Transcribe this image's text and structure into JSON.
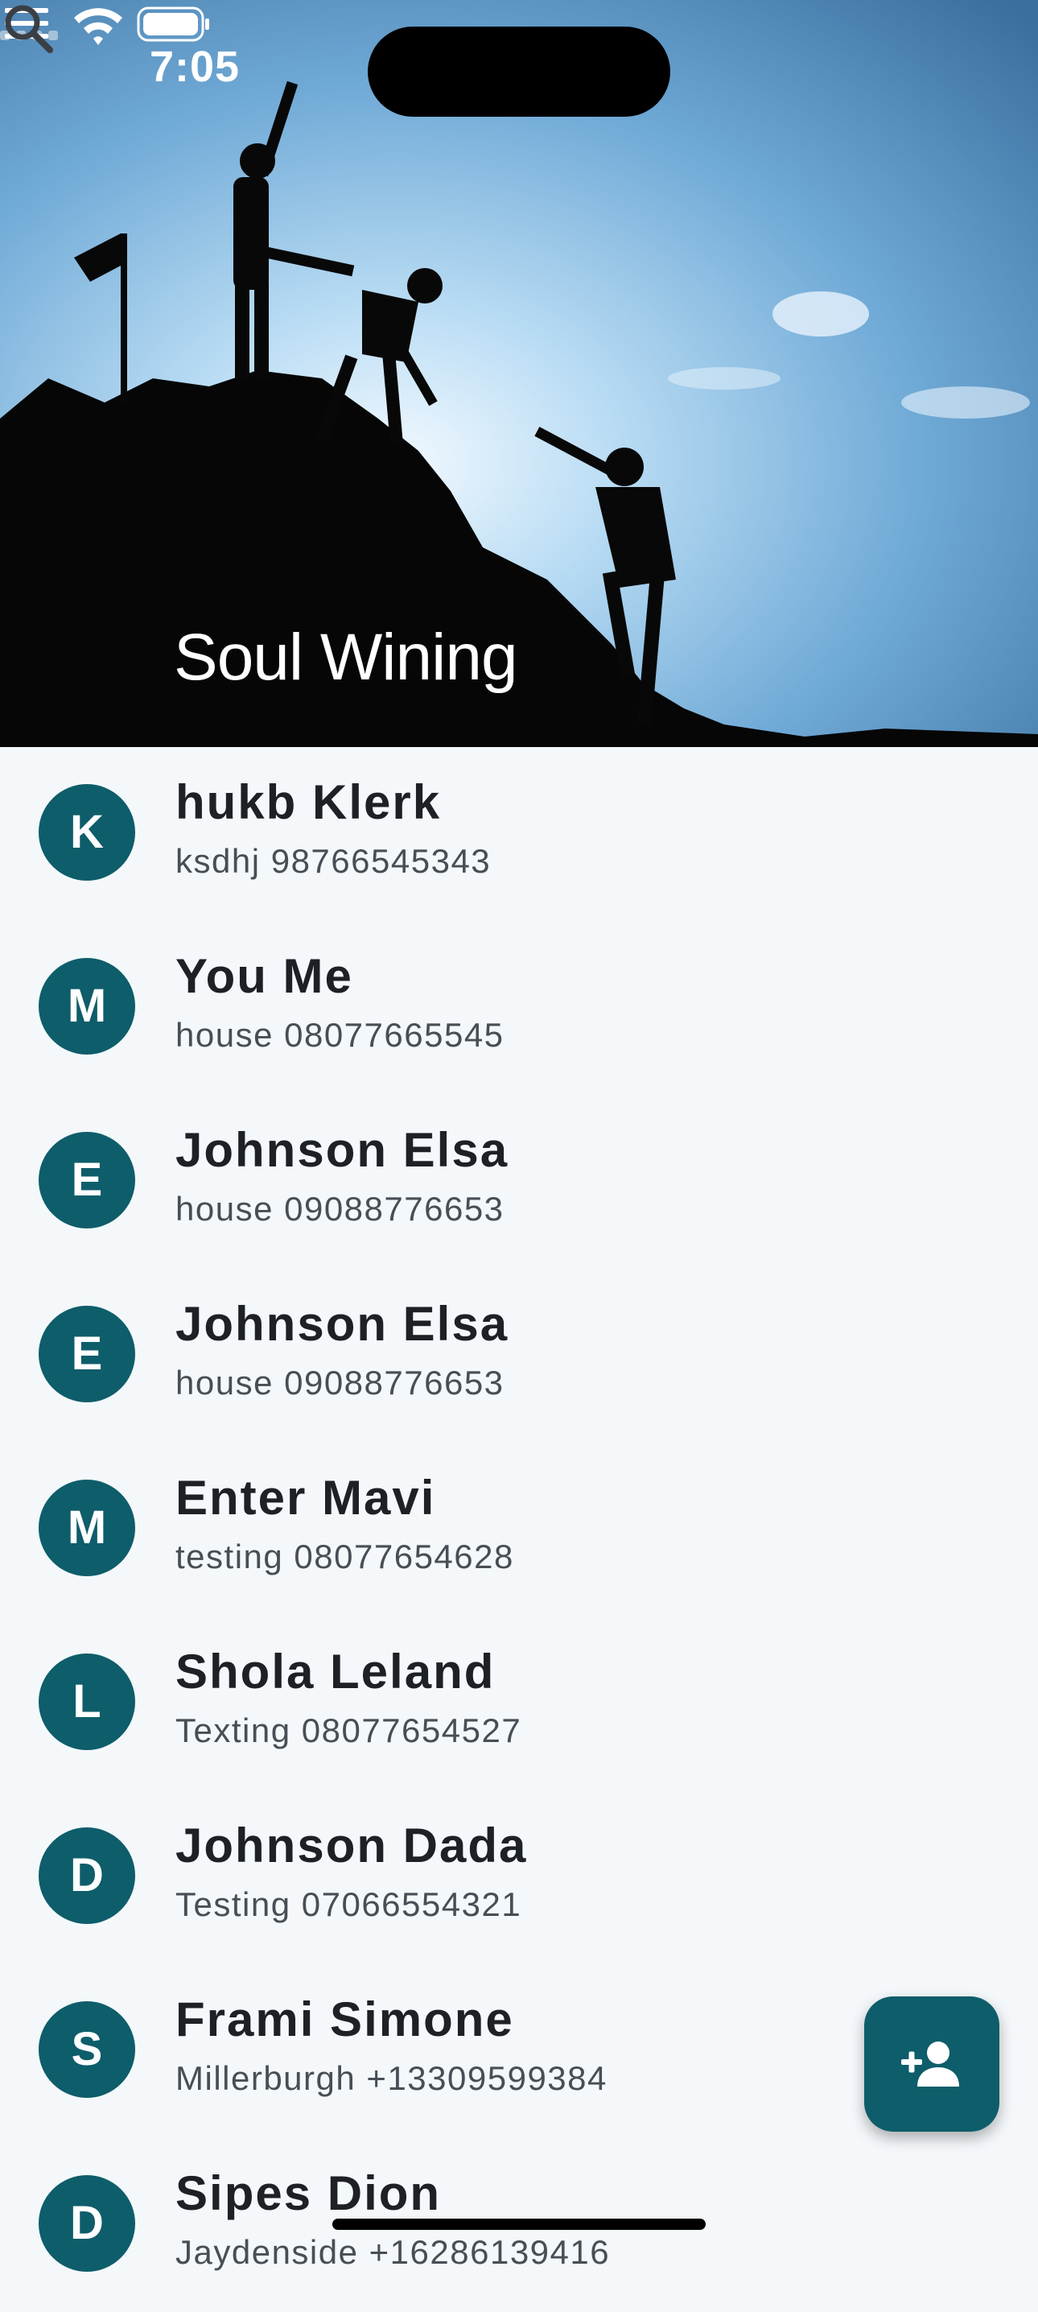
{
  "status_bar": {
    "time": "7:05"
  },
  "header": {
    "title": "Soul Wining",
    "menu_icon": "hamburger-menu-icon",
    "search_icon": "search-icon"
  },
  "contacts": [
    {
      "initial": "K",
      "name": "hukb Klerk",
      "detail": "ksdhj 98766545343"
    },
    {
      "initial": "M",
      "name": "You Me",
      "detail": "house 08077665545"
    },
    {
      "initial": "E",
      "name": "Johnson Elsa",
      "detail": "house 09088776653"
    },
    {
      "initial": "E",
      "name": "Johnson Elsa",
      "detail": "house 09088776653"
    },
    {
      "initial": "M",
      "name": "Enter Mavi",
      "detail": "testing 08077654628"
    },
    {
      "initial": "L",
      "name": "Shola Leland",
      "detail": "Texting 08077654527"
    },
    {
      "initial": "D",
      "name": "Johnson Dada",
      "detail": "Testing 07066554321"
    },
    {
      "initial": "S",
      "name": "Frami Simone",
      "detail": "Millerburgh +13309599384"
    },
    {
      "initial": "D",
      "name": "Sipes Dion",
      "detail": "Jaydenside +16286139416"
    }
  ],
  "fab": {
    "icon": "add-person-icon"
  },
  "colors": {
    "accent": "#0e5d6a",
    "background": "#f4f8fb",
    "sky": "#5a9ccc"
  }
}
